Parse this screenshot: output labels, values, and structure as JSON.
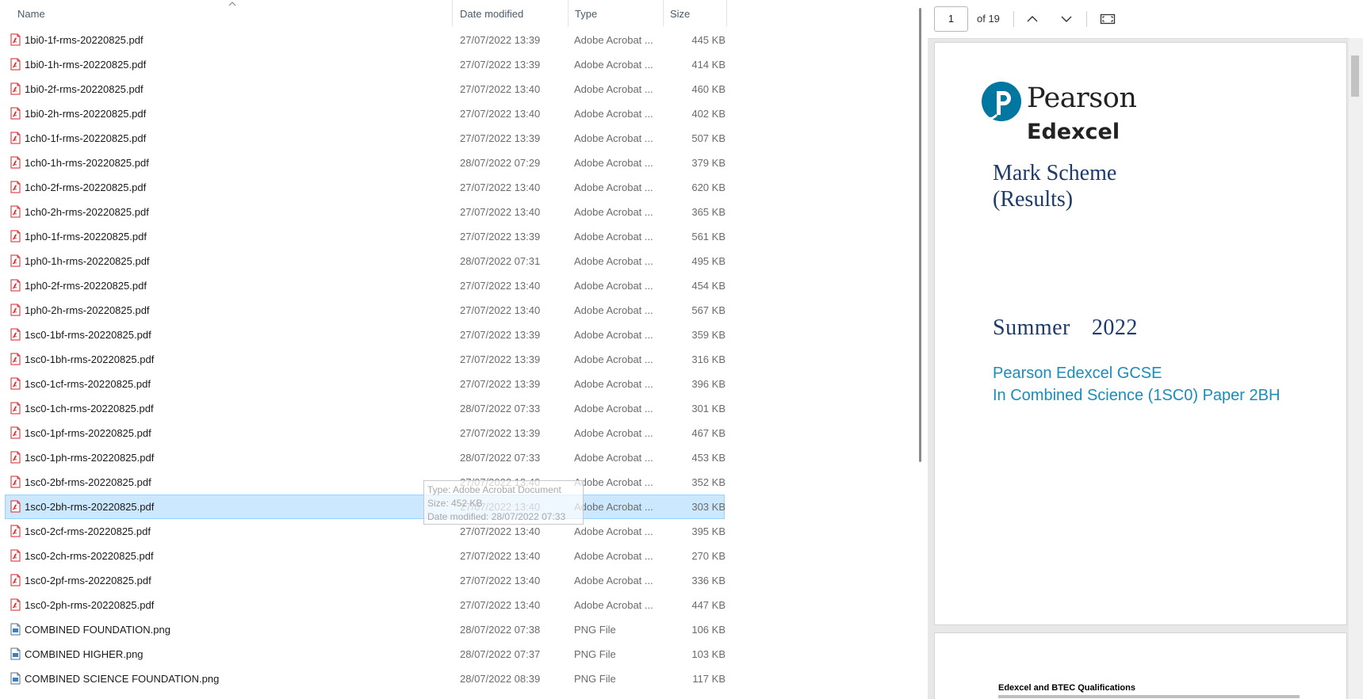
{
  "file_list": {
    "columns": {
      "name": "Name",
      "date_modified": "Date modified",
      "type": "Type",
      "size": "Size"
    },
    "files": [
      {
        "name": "1bi0-1f-rms-20220825.pdf",
        "date": "27/07/2022 13:39",
        "type": "Adobe Acrobat ...",
        "size": "445 KB",
        "kind": "pdf"
      },
      {
        "name": "1bi0-1h-rms-20220825.pdf",
        "date": "27/07/2022 13:39",
        "type": "Adobe Acrobat ...",
        "size": "414 KB",
        "kind": "pdf"
      },
      {
        "name": "1bi0-2f-rms-20220825.pdf",
        "date": "27/07/2022 13:40",
        "type": "Adobe Acrobat ...",
        "size": "460 KB",
        "kind": "pdf"
      },
      {
        "name": "1bi0-2h-rms-20220825.pdf",
        "date": "27/07/2022 13:40",
        "type": "Adobe Acrobat ...",
        "size": "402 KB",
        "kind": "pdf"
      },
      {
        "name": "1ch0-1f-rms-20220825.pdf",
        "date": "27/07/2022 13:39",
        "type": "Adobe Acrobat ...",
        "size": "507 KB",
        "kind": "pdf"
      },
      {
        "name": "1ch0-1h-rms-20220825.pdf",
        "date": "28/07/2022 07:29",
        "type": "Adobe Acrobat ...",
        "size": "379 KB",
        "kind": "pdf"
      },
      {
        "name": "1ch0-2f-rms-20220825.pdf",
        "date": "27/07/2022 13:40",
        "type": "Adobe Acrobat ...",
        "size": "620 KB",
        "kind": "pdf"
      },
      {
        "name": "1ch0-2h-rms-20220825.pdf",
        "date": "27/07/2022 13:40",
        "type": "Adobe Acrobat ...",
        "size": "365 KB",
        "kind": "pdf"
      },
      {
        "name": "1ph0-1f-rms-20220825.pdf",
        "date": "27/07/2022 13:39",
        "type": "Adobe Acrobat ...",
        "size": "561 KB",
        "kind": "pdf"
      },
      {
        "name": "1ph0-1h-rms-20220825.pdf",
        "date": "28/07/2022 07:31",
        "type": "Adobe Acrobat ...",
        "size": "495 KB",
        "kind": "pdf"
      },
      {
        "name": "1ph0-2f-rms-20220825.pdf",
        "date": "27/07/2022 13:40",
        "type": "Adobe Acrobat ...",
        "size": "454 KB",
        "kind": "pdf"
      },
      {
        "name": "1ph0-2h-rms-20220825.pdf",
        "date": "27/07/2022 13:40",
        "type": "Adobe Acrobat ...",
        "size": "567 KB",
        "kind": "pdf"
      },
      {
        "name": "1sc0-1bf-rms-20220825.pdf",
        "date": "27/07/2022 13:39",
        "type": "Adobe Acrobat ...",
        "size": "359 KB",
        "kind": "pdf"
      },
      {
        "name": "1sc0-1bh-rms-20220825.pdf",
        "date": "27/07/2022 13:39",
        "type": "Adobe Acrobat ...",
        "size": "316 KB",
        "kind": "pdf"
      },
      {
        "name": "1sc0-1cf-rms-20220825.pdf",
        "date": "27/07/2022 13:39",
        "type": "Adobe Acrobat ...",
        "size": "396 KB",
        "kind": "pdf"
      },
      {
        "name": "1sc0-1ch-rms-20220825.pdf",
        "date": "28/07/2022 07:33",
        "type": "Adobe Acrobat ...",
        "size": "301 KB",
        "kind": "pdf"
      },
      {
        "name": "1sc0-1pf-rms-20220825.pdf",
        "date": "27/07/2022 13:39",
        "type": "Adobe Acrobat ...",
        "size": "467 KB",
        "kind": "pdf"
      },
      {
        "name": "1sc0-1ph-rms-20220825.pdf",
        "date": "28/07/2022 07:33",
        "type": "Adobe Acrobat ...",
        "size": "453 KB",
        "kind": "pdf"
      },
      {
        "name": "1sc0-2bf-rms-20220825.pdf",
        "date": "27/07/2022 13:40",
        "type": "Adobe Acrobat ...",
        "size": "352 KB",
        "kind": "pdf"
      },
      {
        "name": "1sc0-2bh-rms-20220825.pdf",
        "date": "27/07/2022 13:40",
        "type": "Adobe Acrobat ...",
        "size": "303 KB",
        "kind": "pdf",
        "selected": true
      },
      {
        "name": "1sc0-2cf-rms-20220825.pdf",
        "date": "27/07/2022 13:40",
        "type": "Adobe Acrobat ...",
        "size": "395 KB",
        "kind": "pdf"
      },
      {
        "name": "1sc0-2ch-rms-20220825.pdf",
        "date": "27/07/2022 13:40",
        "type": "Adobe Acrobat ...",
        "size": "270 KB",
        "kind": "pdf"
      },
      {
        "name": "1sc0-2pf-rms-20220825.pdf",
        "date": "27/07/2022 13:40",
        "type": "Adobe Acrobat ...",
        "size": "336 KB",
        "kind": "pdf"
      },
      {
        "name": "1sc0-2ph-rms-20220825.pdf",
        "date": "27/07/2022 13:40",
        "type": "Adobe Acrobat ...",
        "size": "447 KB",
        "kind": "pdf"
      },
      {
        "name": "COMBINED FOUNDATION.png",
        "date": "28/07/2022 07:38",
        "type": "PNG File",
        "size": "106 KB",
        "kind": "png"
      },
      {
        "name": "COMBINED HIGHER.png",
        "date": "28/07/2022 07:37",
        "type": "PNG File",
        "size": "103 KB",
        "kind": "png"
      },
      {
        "name": "COMBINED SCIENCE FOUNDATION.png",
        "date": "28/07/2022 08:39",
        "type": "PNG File",
        "size": "117 KB",
        "kind": "png"
      }
    ],
    "tooltip": {
      "type_line": "Type: Adobe Acrobat Document",
      "size_line": "Size: 452 KB",
      "date_line": "Date modified: 28/07/2022 07:33"
    }
  },
  "preview": {
    "page_number": "1",
    "page_count": "of 19",
    "document": {
      "brand_name": "Pearson",
      "brand_sub": "Edexcel",
      "title_line1": "Mark Scheme",
      "title_line2": "(Results)",
      "session": "Summer  2022",
      "qualification_line1": "Pearson Edexcel GCSE",
      "qualification_line2": "In Combined Science (1SC0) Paper 2BH",
      "page2_heading": "Edexcel and BTEC Qualifications"
    }
  },
  "colors": {
    "selection_bg": "#cce8ff",
    "selection_border": "#99d1ff",
    "pdf_icon": "#d9222a",
    "pearson_blue": "#0077a0",
    "title_navy": "#1e3a6a",
    "qual_blue": "#1a8db8"
  },
  "icons": {
    "pdf_file": "pdf-file-icon",
    "png_file": "image-file-icon",
    "previous_page": "chevron-up-icon",
    "next_page": "chevron-down-icon",
    "fit_page": "fit-page-icon",
    "sort_indicator": "sort-ascending-icon"
  }
}
